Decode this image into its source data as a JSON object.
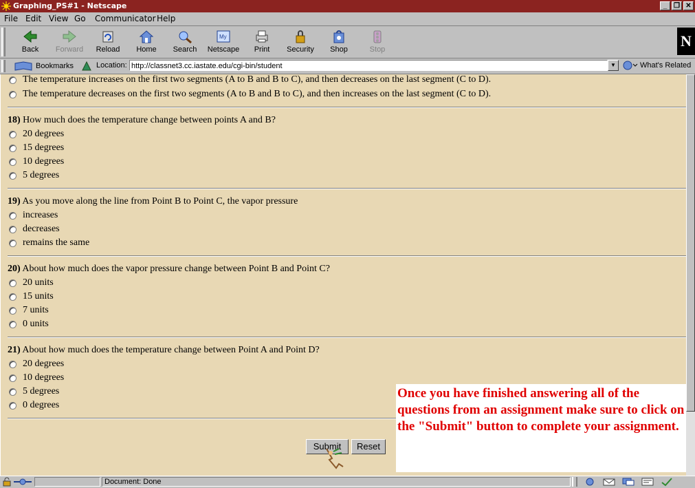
{
  "window": {
    "title": "Graphing_PS#1 - Netscape"
  },
  "menubar": [
    "File",
    "Edit",
    "View",
    "Go",
    "Communicator",
    "Help"
  ],
  "toolbar": {
    "buttons": [
      {
        "label": "Back",
        "icon": "back-arrow-icon"
      },
      {
        "label": "Forward",
        "icon": "forward-arrow-icon",
        "disabled": true
      },
      {
        "label": "Reload",
        "icon": "reload-icon"
      },
      {
        "label": "Home",
        "icon": "home-icon"
      },
      {
        "label": "Search",
        "icon": "search-icon"
      },
      {
        "label": "Netscape",
        "icon": "netscape-icon"
      },
      {
        "label": "Print",
        "icon": "print-icon"
      },
      {
        "label": "Security",
        "icon": "lock-icon"
      },
      {
        "label": "Shop",
        "icon": "shop-icon"
      },
      {
        "label": "Stop",
        "icon": "stop-icon",
        "disabled": true
      }
    ]
  },
  "location": {
    "bookmarks_label": "Bookmarks",
    "location_label": "Location:",
    "url": "http://classnet3.cc.iastate.edu/cgi-bin/student",
    "whats_related": "What's Related"
  },
  "content": {
    "prev_options": [
      "The temperature increases on the first two segments (A to B and B to C), and then decreases on the last segment (C to D).",
      "The temperature decreases on the first two segments (A to B and B to C), and then increases on the last segment (C to D)."
    ],
    "questions": [
      {
        "num": "18)",
        "text": "How much does the temperature change between points A and B?",
        "options": [
          "20 degrees",
          "15 degrees",
          "10 degrees",
          "5 degrees"
        ]
      },
      {
        "num": "19)",
        "text": "As you move along the line from Point B to Point C, the vapor pressure",
        "options": [
          "increases",
          "decreases",
          "remains the same"
        ]
      },
      {
        "num": "20)",
        "text": "About how much does the vapor pressure change between Point B and Point C?",
        "options": [
          "20 units",
          "15 units",
          "7 units",
          "0 units"
        ]
      },
      {
        "num": "21)",
        "text": "About how much does the temperature change between Point A and Point D?",
        "options": [
          "20 degrees",
          "10 degrees",
          "5 degrees",
          "0 degrees"
        ]
      }
    ],
    "submit_label": "Submit",
    "reset_label": "Reset",
    "note": "Once you have finished answering all of the questions from an assignment make sure to click on the \"Submit\" button to complete your assignment."
  },
  "status": {
    "text": "Document: Done"
  }
}
